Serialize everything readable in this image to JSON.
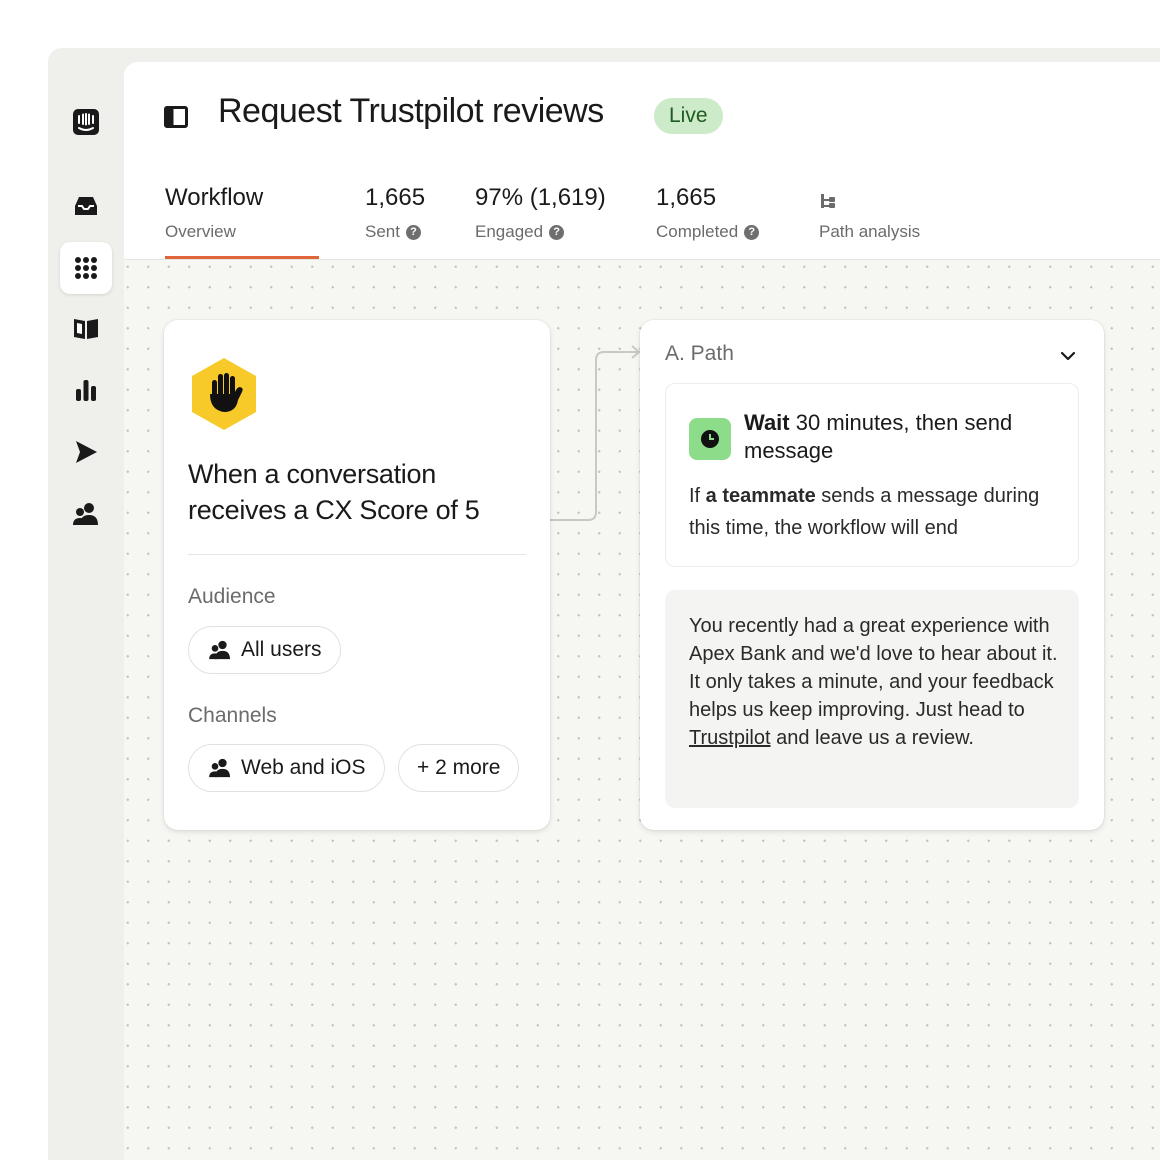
{
  "header": {
    "title": "Request Trustpilot reviews",
    "status_badge": "Live"
  },
  "stats_bar": {
    "tab": {
      "title": "Workflow",
      "subtitle": "Overview"
    },
    "items": [
      {
        "value": "1,665",
        "label": "Sent",
        "help": "?"
      },
      {
        "value": "97% (1,619)",
        "label": "Engaged",
        "help": "?"
      },
      {
        "value": "1,665",
        "label": "Completed",
        "help": "?"
      }
    ],
    "path_analysis": {
      "label": "Path analysis",
      "icon": "tree-icon"
    }
  },
  "nav_rail": [
    {
      "icon": "intercom-logo-icon",
      "active": false
    },
    {
      "icon": "inbox-icon",
      "active": false
    },
    {
      "icon": "apps-grid-icon",
      "active": true
    },
    {
      "icon": "book-icon",
      "active": false
    },
    {
      "icon": "bar-chart-icon",
      "active": false
    },
    {
      "icon": "send-icon",
      "active": false
    },
    {
      "icon": "users-icon",
      "active": false
    }
  ],
  "trigger": {
    "icon": "raised-hand-icon",
    "icon_color": "#f7c929",
    "title": "When a conversation receives a CX Score of 5",
    "audience_label": "Audience",
    "audience_value": "All users",
    "channels_label": "Channels",
    "channels_value": "Web and iOS",
    "channels_more": "+ 2 more"
  },
  "path": {
    "title": "A. Path",
    "wait": {
      "bold": "Wait",
      "rest": " 30 minutes, then send message",
      "condition_prefix": "If ",
      "condition_bold": "a teammate",
      "condition_rest": " sends a message during this time, the workflow will end"
    },
    "message": {
      "before_link": "You recently had a great experience with Apex Bank and we'd love to hear about it. It only takes a minute, and your feedback helps us keep improving. Just head to ",
      "link": "Trustpilot",
      "after_link": " and leave us a review."
    }
  },
  "colors": {
    "accent_tab": "#e0663a",
    "live_badge_bg": "#cdeac9",
    "wait_icon_bg": "#8ddc8a"
  }
}
